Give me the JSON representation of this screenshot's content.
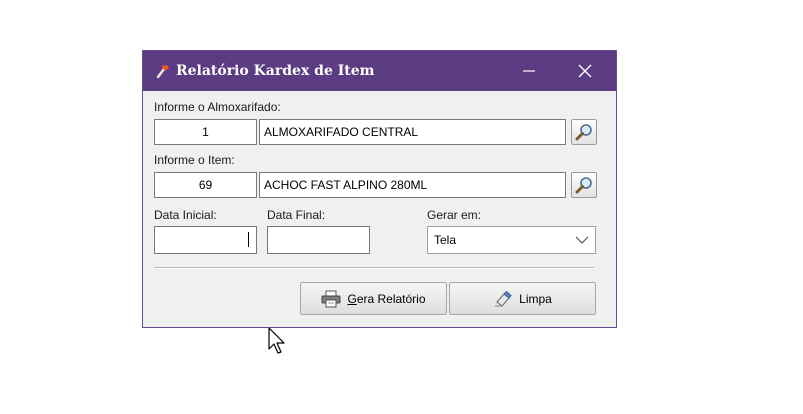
{
  "window": {
    "title": "Relatório Kardex de Item",
    "accent_color": "#5b3b82",
    "icon": "hammer-icon"
  },
  "almoxarifado": {
    "label": "Informe o Almoxarifado:",
    "code": "1",
    "name": "ALMOXARIFADO CENTRAL",
    "lookup_icon": "magnifier-icon"
  },
  "item": {
    "label": "Informe o Item:",
    "code": "69",
    "name": "ACHOC FAST ALPINO 280ML",
    "lookup_icon": "magnifier-icon"
  },
  "dates": {
    "start_label": "Data Inicial:",
    "start_value": "",
    "end_label": "Data Final:",
    "end_value": ""
  },
  "output": {
    "label": "Gerar em:",
    "selected": "Tela"
  },
  "buttons": {
    "report_mnemonic": "G",
    "report_rest": "era Relatório",
    "report_icon": "printer-icon",
    "clear_label": "Limpa",
    "clear_icon": "eraser-icon"
  }
}
